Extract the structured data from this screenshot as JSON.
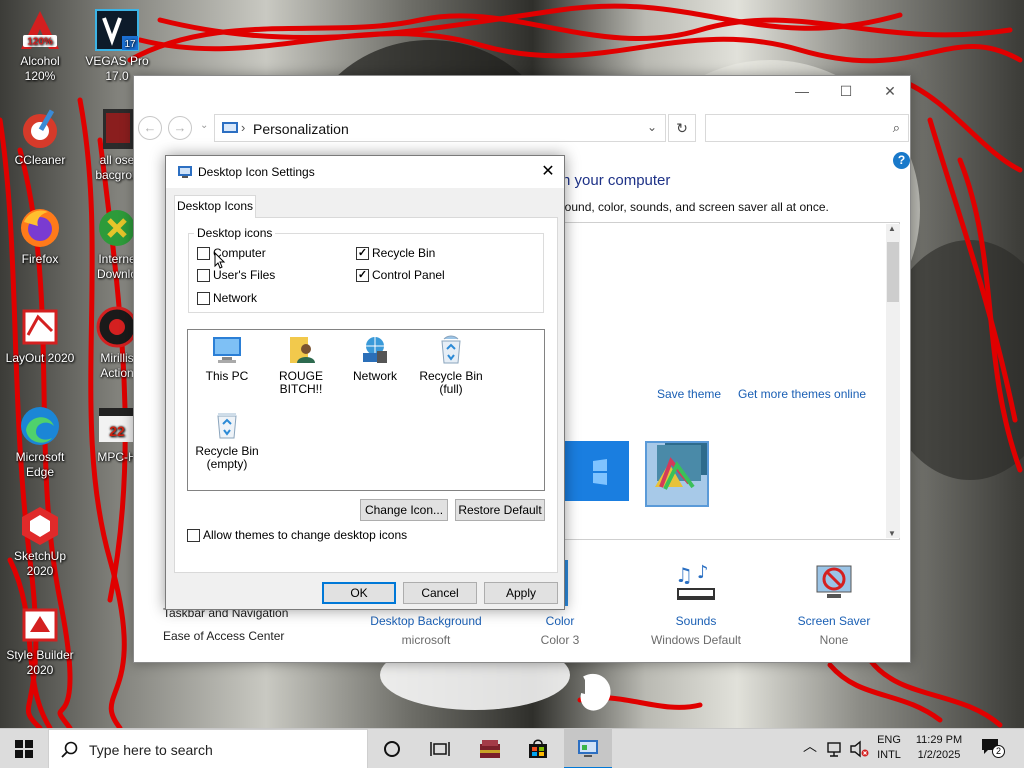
{
  "desktop": {
    "left_column": [
      {
        "label": "Alcohol\n120%",
        "icon": "alcohol-120-icon",
        "badge": "120%"
      },
      {
        "label": "CCleaner",
        "icon": "ccleaner-icon"
      },
      {
        "label": "Firefox",
        "icon": "firefox-icon"
      },
      {
        "label": "LayOut 2020",
        "icon": "layout-icon"
      },
      {
        "label": "Microsoft\nEdge",
        "icon": "edge-icon"
      },
      {
        "label": "SketchUp\n2020",
        "icon": "sketchup-icon"
      },
      {
        "label": "Style Builder\n2020",
        "icon": "style-builder-icon"
      }
    ],
    "right_column": [
      {
        "label": "VEGAS Pro\n17.0",
        "icon": "vegas-pro-icon",
        "badge": "17"
      },
      {
        "label": "all ose\nbacgrou",
        "icon": "folder-image-icon"
      },
      {
        "label": "Interne\nDownlo",
        "icon": "internet-download-manager-icon"
      },
      {
        "label": "Mirillis\nAction",
        "icon": "mirillis-action-icon"
      },
      {
        "label": "MPC-H",
        "icon": "mpc-hc-icon"
      }
    ]
  },
  "control_panel": {
    "address": "Personalization",
    "heading": "s on your computer",
    "subheading": "ckground, color, sounds, and screen saver all at once.",
    "save_theme": "Save theme",
    "more_themes": "Get more themes online",
    "left_links": [
      "Taskbar and Navigation",
      "Ease of Access Center"
    ],
    "bottom_items": [
      {
        "name": "Desktop Background",
        "value": "microsoft",
        "icon": "desktop-background-icon"
      },
      {
        "name": "Color",
        "value": "Color 3",
        "icon": "color-icon"
      },
      {
        "name": "Sounds",
        "value": "Windows Default",
        "icon": "sounds-icon"
      },
      {
        "name": "Screen Saver",
        "value": "None",
        "icon": "screen-saver-icon"
      }
    ],
    "window_controls": {
      "minimize": "—",
      "maximize": "☐",
      "close": "✕"
    }
  },
  "dialog": {
    "title": "Desktop Icon Settings",
    "tab": "Desktop Icons",
    "group_label": "Desktop icons",
    "checkboxes": [
      {
        "label": "Computer",
        "checked": false
      },
      {
        "label": "User's Files",
        "checked": false
      },
      {
        "label": "Network",
        "checked": false
      },
      {
        "label": "Recycle Bin",
        "checked": true
      },
      {
        "label": "Control Panel",
        "checked": true
      }
    ],
    "preview_icons": [
      {
        "label": "This PC",
        "icon": "this-pc-icon"
      },
      {
        "label": "ROUGE\nBITCH!!",
        "icon": "user-folder-icon"
      },
      {
        "label": "Network",
        "icon": "network-icon"
      },
      {
        "label": "Recycle Bin\n(full)",
        "icon": "recycle-bin-full-icon"
      },
      {
        "label": "Recycle Bin\n(empty)",
        "icon": "recycle-bin-empty-icon"
      }
    ],
    "change_icon": "Change Icon...",
    "restore_default": "Restore Default",
    "allow_themes": "Allow themes to change desktop icons",
    "ok": "OK",
    "cancel": "Cancel",
    "apply": "Apply"
  },
  "taskbar": {
    "search_placeholder": "Type here to search",
    "language_1": "ENG",
    "language_2": "INTL",
    "time": "11:29 PM",
    "date": "1/2/2025",
    "notification_count": "2"
  },
  "colors": {
    "accent": "#0078d7",
    "link": "#1a5fb4",
    "scribble": "#e00000"
  }
}
